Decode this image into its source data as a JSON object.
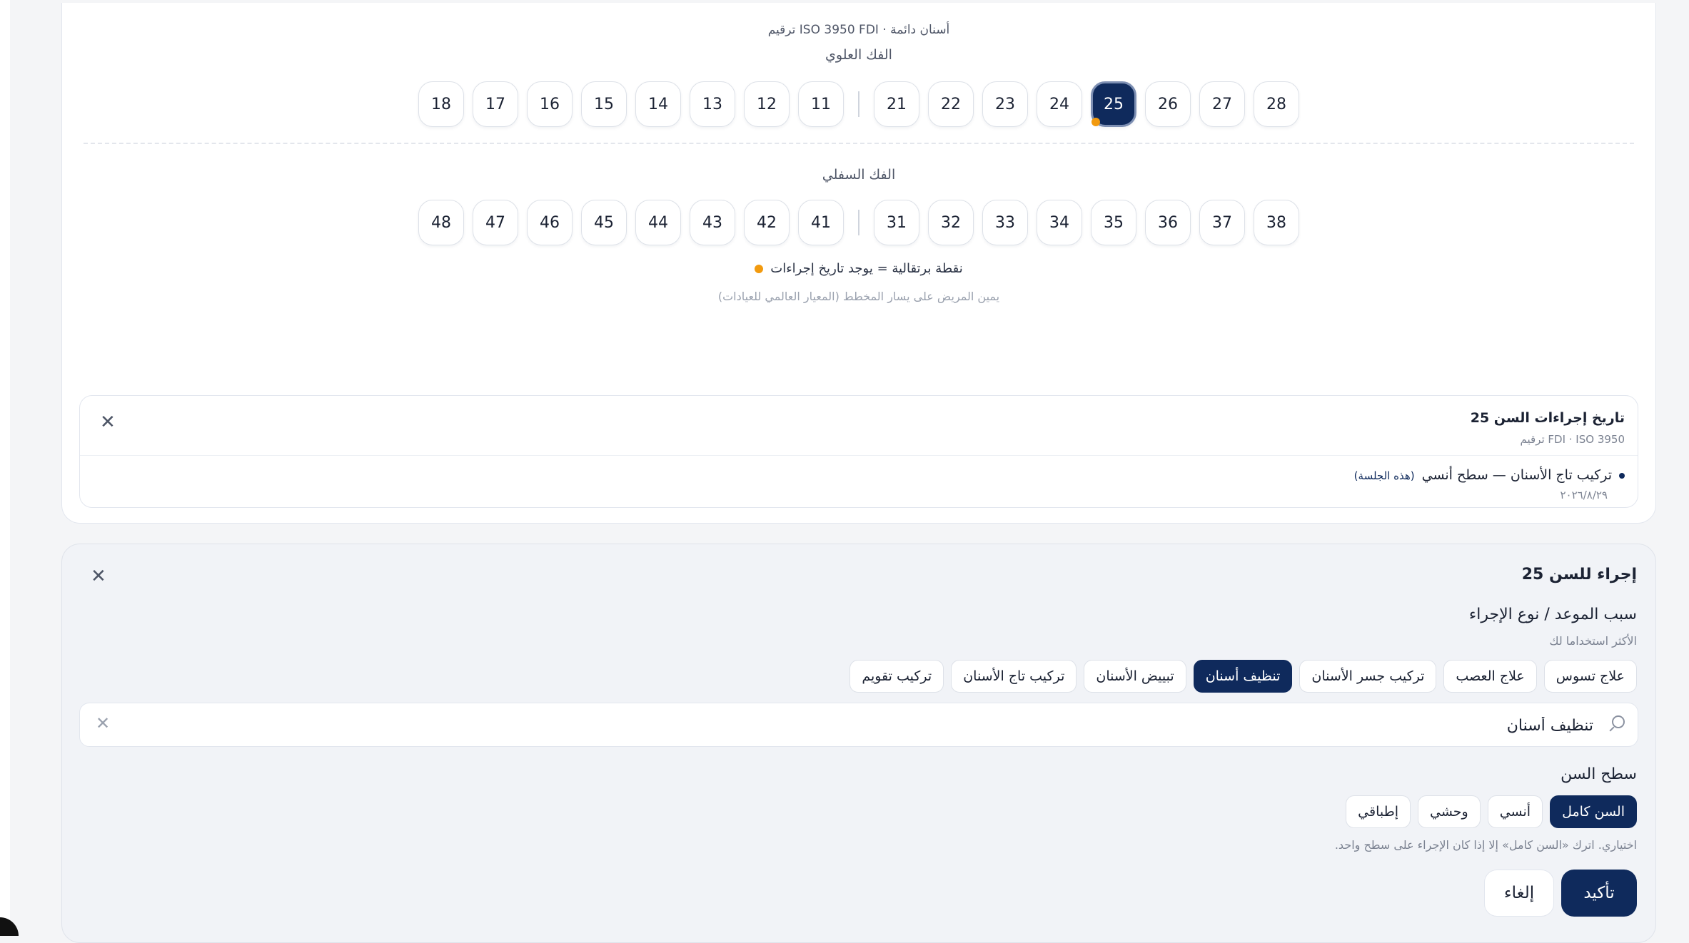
{
  "chart": {
    "subtitle": "أسنان دائمة · ISO 3950 FDI ترقيم",
    "upper_label": "الفك العلوي",
    "lower_label": "الفك السفلي",
    "upper_left": [
      "18",
      "17",
      "16",
      "15",
      "14",
      "13",
      "12",
      "11"
    ],
    "upper_right": [
      "21",
      "22",
      "23",
      "24",
      "25",
      "26",
      "27",
      "28"
    ],
    "lower_left": [
      "48",
      "47",
      "46",
      "45",
      "44",
      "43",
      "42",
      "41"
    ],
    "lower_right": [
      "31",
      "32",
      "33",
      "34",
      "35",
      "36",
      "37",
      "38"
    ],
    "selected_tooth": "25",
    "teeth_with_history": [
      "25"
    ],
    "legend_text": "نقطة برتقالية = يوجد تاريخ إجراءات",
    "orientation_note": "يمين المريض على يسار المخطط (المعيار العالمي للعيادات)",
    "accent_color": "#0f2a5c",
    "history_dot_color": "#f29a0e"
  },
  "history": {
    "title": "تاريخ إجراءات السن 25",
    "subtitle": "FDI · ISO 3950 ترقيم",
    "close_icon": "close-icon",
    "entries": [
      {
        "text": "تركيب تاج الأسنان — سطح أنسي",
        "tag": "(هذه الجلسة)",
        "date": "٢٠٢٦/٨/٢٩"
      }
    ]
  },
  "procedure": {
    "title": "إجراء للسن 25",
    "close_icon": "close-icon",
    "reason_label": "سبب الموعد / نوع الإجراء",
    "frequent_label": "الأكثر استخداما لك",
    "chips": [
      "علاج تسوس",
      "علاج العصب",
      "تركيب جسر الأسنان",
      "تنظيف أسنان",
      "تبييض الأسنان",
      "تركيب تاج الأسنان",
      "تركيب تقويم"
    ],
    "active_chip": "تنظيف أسنان",
    "search_value": "تنظيف أسنان",
    "surface_label": "سطح السن",
    "surfaces": [
      "السن كامل",
      "أنسي",
      "وحشي",
      "إطباقي"
    ],
    "active_surface": "السن كامل",
    "surface_hint": "اختياري. اترك «السن كامل» إلا إذا كان الإجراء على سطح واحد.",
    "confirm_label": "تأكيد",
    "cancel_label": "إلغاء"
  }
}
